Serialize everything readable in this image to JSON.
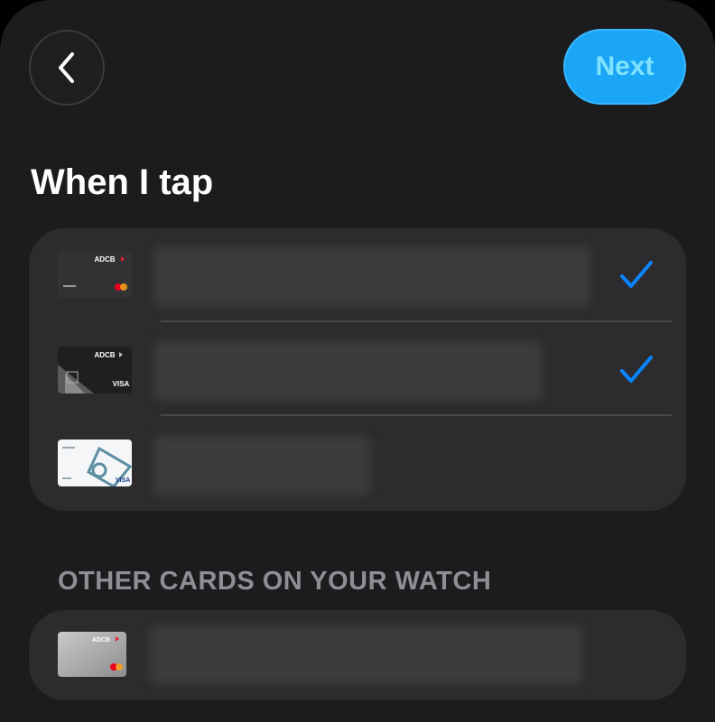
{
  "nav": {
    "back_icon": "chevron-left-icon",
    "next_label": "Next"
  },
  "title": "When I tap",
  "tap_cards": [
    {
      "brand": "ADCB",
      "network": "mastercard",
      "selected": true
    },
    {
      "brand": "ADCB",
      "network": "VISA",
      "selected": true
    },
    {
      "brand": "",
      "network": "VISA",
      "selected": false
    }
  ],
  "other_section": {
    "header": "OTHER CARDS ON YOUR WATCH"
  },
  "other_cards": [
    {
      "brand": "ADCB",
      "network": "mastercard"
    }
  ],
  "colors": {
    "accent": "#1ba6f5",
    "check": "#0a84ff",
    "background": "#1c1c1e",
    "group": "#2c2c2e"
  }
}
